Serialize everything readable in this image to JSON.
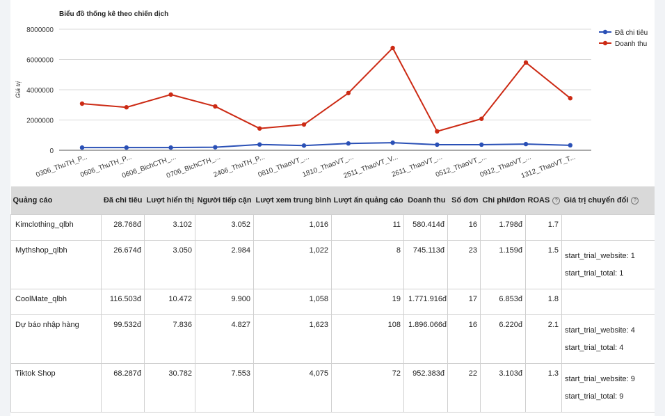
{
  "chart_data": {
    "type": "line",
    "title": "Biểu đồ thống kê theo chiến dịch",
    "ylabel": "Giá trị",
    "xlabel": "",
    "ylim": [
      0,
      8000000
    ],
    "yticks": [
      "0",
      "2000000",
      "4000000",
      "6000000",
      "8000000"
    ],
    "yticks_values": [
      0,
      2000000,
      4000000,
      6000000,
      8000000
    ],
    "categories": [
      "0306_ThuTH_P...",
      "0606_ThuTH_P...",
      "0606_BichCTH_...",
      "0706_BichCTH_...",
      "2406_ThuTH_P...",
      "0810_ThaoVT_...",
      "1810_ThaoVT_...",
      "2511_ThaoVT_V...",
      "2611_ThaoVT_...",
      "0512_ThaoVT_...",
      "0912_ThaoVT_...",
      "1312_ThaoVT_T..."
    ],
    "grid": true,
    "legend_placement": "right",
    "series": [
      {
        "name": "Đã chi tiêu",
        "color": "#2a50b6",
        "values": [
          180000,
          180000,
          180000,
          200000,
          380000,
          310000,
          450000,
          500000,
          370000,
          370000,
          410000,
          330000
        ]
      },
      {
        "name": "Doanh thu",
        "color": "#cc2a14",
        "values": [
          3080000,
          2840000,
          3680000,
          2900000,
          1440000,
          1700000,
          3780000,
          6760000,
          1250000,
          2080000,
          5800000,
          3440000
        ]
      }
    ]
  },
  "table": {
    "headers": [
      "Quảng cáo",
      "Đã chi tiêu",
      "Lượt hiển thị",
      "Người tiếp cận",
      "Lượt xem trung bình",
      "Lượt ấn quảng cáo",
      "Doanh thu",
      "Số đơn",
      "Chi phí/đơn",
      "ROAS",
      "Giá trị chuyển đổi"
    ],
    "help_icon": "question-circle-icon",
    "help_glyph": "?",
    "rows": [
      {
        "name": "Kimclothing_qlbh",
        "spent": "28.768đ",
        "impressions": "3.102",
        "reach": "3.052",
        "avg_views": "1,016",
        "clicks": "11",
        "revenue": "580.414đ",
        "orders": "16",
        "cost_per_order": "1.798đ",
        "roas": "1.7",
        "conv": []
      },
      {
        "name": "Mythshop_qlbh",
        "spent": "26.674đ",
        "impressions": "3.050",
        "reach": "2.984",
        "avg_views": "1,022",
        "clicks": "8",
        "revenue": "745.113đ",
        "orders": "23",
        "cost_per_order": "1.159đ",
        "roas": "1.5",
        "conv": [
          "start_trial_website: 1",
          "start_trial_total: 1"
        ]
      },
      {
        "name": "CoolMate_qlbh",
        "spent": "116.503đ",
        "impressions": "10.472",
        "reach": "9.900",
        "avg_views": "1,058",
        "clicks": "19",
        "revenue": "1.771.916đ",
        "orders": "17",
        "cost_per_order": "6.853đ",
        "roas": "1.8",
        "conv": []
      },
      {
        "name": "Dự báo nhập hàng",
        "spent": "99.532đ",
        "impressions": "7.836",
        "reach": "4.827",
        "avg_views": "1,623",
        "clicks": "108",
        "revenue": "1.896.066đ",
        "orders": "16",
        "cost_per_order": "6.220đ",
        "roas": "2.1",
        "conv": [
          "start_trial_website: 4",
          "start_trial_total: 4"
        ]
      },
      {
        "name": "Tiktok Shop",
        "spent": "68.287đ",
        "impressions": "30.782",
        "reach": "7.553",
        "avg_views": "4,075",
        "clicks": "72",
        "revenue": "952.383đ",
        "orders": "22",
        "cost_per_order": "3.103đ",
        "roas": "1.3",
        "conv": [
          "start_trial_website: 9",
          "start_trial_total: 9"
        ]
      }
    ]
  }
}
